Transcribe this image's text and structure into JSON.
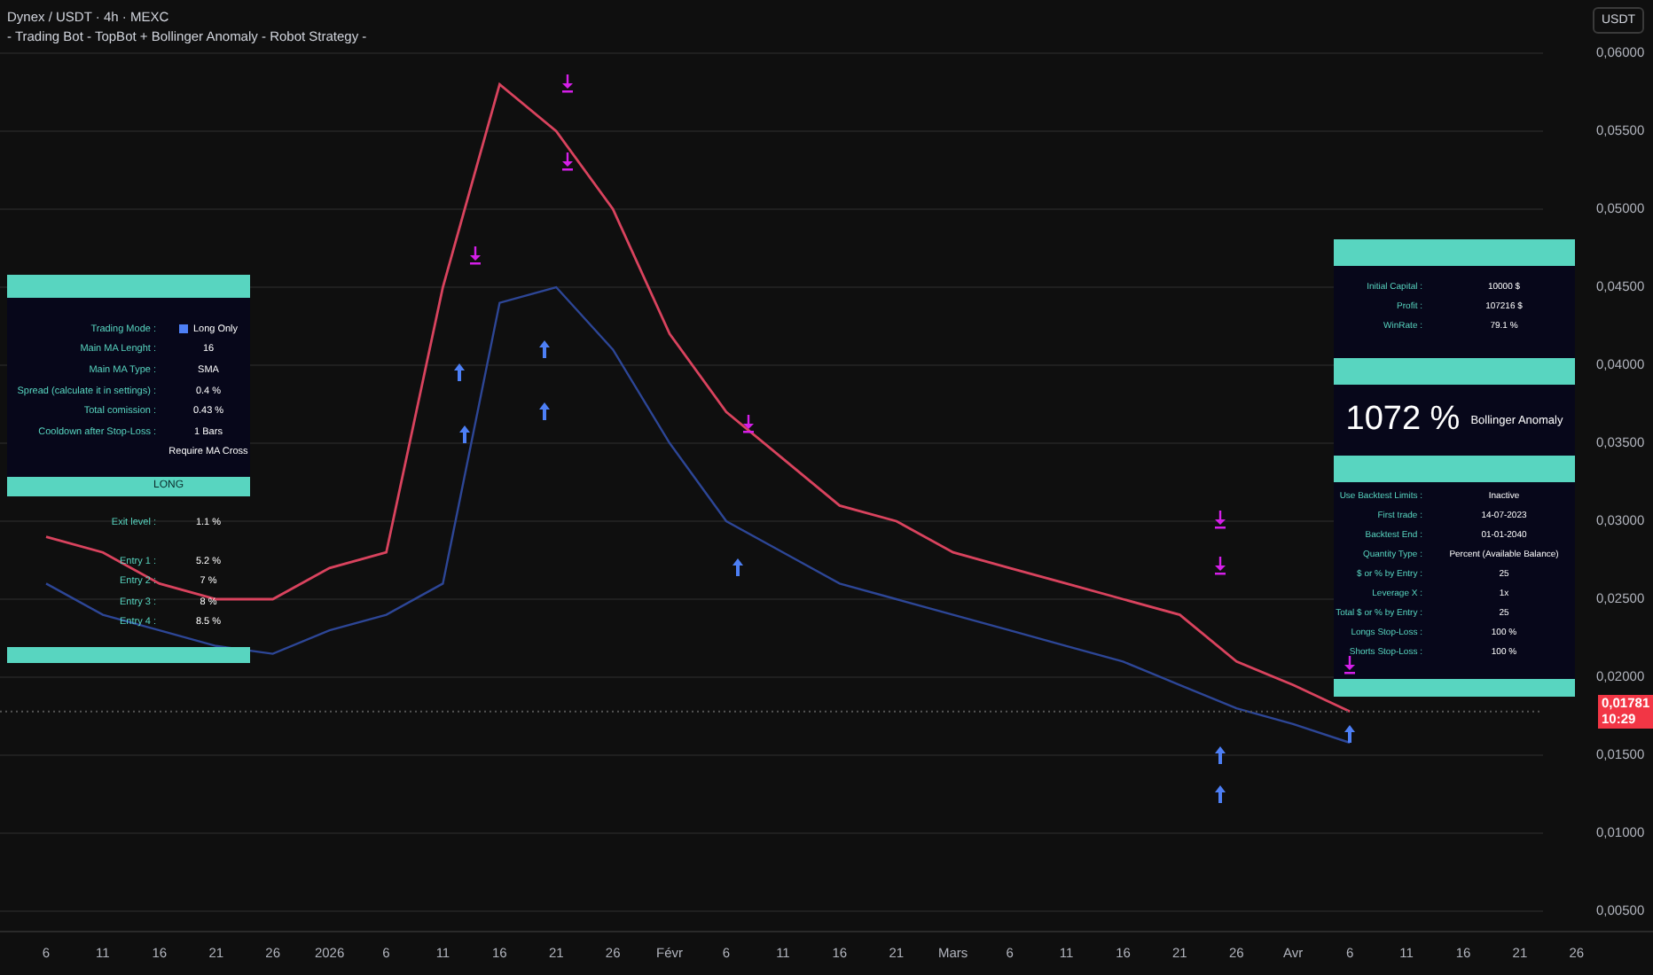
{
  "header": {
    "symbol": "Dynex / USDT · 4h · MEXC",
    "strategy": "- Trading Bot - TopBot + Bollinger Anomaly - Robot Strategy -"
  },
  "currency_button": "USDT",
  "chart_data": {
    "type": "line",
    "ylim": [
      0.005,
      0.06
    ],
    "grid": true,
    "categories": [
      "6",
      "11",
      "16",
      "21",
      "26",
      "2026",
      "6",
      "11",
      "16",
      "21",
      "26",
      "Févr",
      "6",
      "11",
      "16",
      "21",
      "Mars",
      "6",
      "11",
      "16",
      "21",
      "26",
      "Avr",
      "6",
      "11",
      "16",
      "21",
      "26"
    ],
    "series": [
      {
        "color": "#d9435e",
        "values": [
          0.029,
          0.028,
          0.026,
          0.025,
          0.025,
          0.027,
          0.028,
          0.045,
          0.058,
          0.055,
          0.05,
          0.042,
          0.037,
          0.034,
          0.031,
          0.03,
          0.028,
          0.027,
          0.026,
          0.025,
          0.024,
          0.021,
          0.0195,
          0.0178,
          null,
          null,
          null,
          null
        ]
      },
      {
        "color": "#2d4696",
        "values": [
          0.026,
          0.024,
          0.023,
          0.022,
          0.0215,
          0.023,
          0.024,
          0.026,
          0.044,
          0.045,
          0.041,
          0.035,
          0.03,
          0.028,
          0.026,
          0.025,
          0.024,
          0.023,
          0.022,
          0.021,
          0.0195,
          0.018,
          0.017,
          0.0158,
          null,
          null,
          null,
          null
        ]
      }
    ],
    "yticks": [
      {
        "value": 0.06,
        "label": "0,06000"
      },
      {
        "value": 0.055,
        "label": "0,05500"
      },
      {
        "value": 0.05,
        "label": "0,05000"
      },
      {
        "value": 0.045,
        "label": "0,04500"
      },
      {
        "value": 0.04,
        "label": "0,04000"
      },
      {
        "value": 0.035,
        "label": "0,03500"
      },
      {
        "value": 0.03,
        "label": "0,03000"
      },
      {
        "value": 0.025,
        "label": "0,02500"
      },
      {
        "value": 0.02,
        "label": "0,02000"
      },
      {
        "value": 0.015,
        "label": "0,01500"
      },
      {
        "value": 0.01,
        "label": "0,01000"
      },
      {
        "value": 0.005,
        "label": "0,00500"
      }
    ]
  },
  "last_price": {
    "price": "0,01781",
    "countdown": "10:29"
  },
  "settings_panel": {
    "rows": [
      {
        "label": "Trading Mode :",
        "value": "Long Only",
        "kind": "swatch"
      },
      {
        "label": "Main MA Lenght :",
        "value": "16"
      },
      {
        "label": "Main MA Type :",
        "value": "SMA"
      },
      {
        "label": "Spread (calculate it in settings) :",
        "value": "0.4 %"
      },
      {
        "label": "Total comission :",
        "value": "0.43 %"
      },
      {
        "label": "Cooldown after Stop-Loss :",
        "value": "1 Bars"
      },
      {
        "value": "Require MA Cross"
      }
    ],
    "section": "LONG",
    "levels": [
      {
        "label": "Exit level :",
        "value": "1.1 %"
      },
      {
        "label": "Entry 1 :",
        "value": "5.2 %"
      },
      {
        "label": "Entry 2 :",
        "value": "7 %"
      },
      {
        "label": "Entry 3 :",
        "value": "8 %"
      },
      {
        "label": "Entry 4 :",
        "value": "8.5 %"
      }
    ]
  },
  "results_panel": {
    "stats": [
      {
        "label": "Initial Capital :",
        "value": "10000 $"
      },
      {
        "label": "Profit :",
        "value": "107216 $"
      },
      {
        "label": "WinRate :",
        "value": "79.1 %"
      }
    ],
    "return": "1072 %",
    "strategy_name": "Bollinger Anomaly",
    "settings": [
      {
        "label": "Use Backtest Limits :",
        "value": "Inactive"
      },
      {
        "label": "First trade :",
        "value": "14-07-2023"
      },
      {
        "label": "Backtest End :",
        "value": "01-01-2040"
      },
      {
        "label": "Quantity Type :",
        "value": "Percent (Available Balance)"
      },
      {
        "label": "$ or % by Entry :",
        "value": "25"
      },
      {
        "label": "Leverage X :",
        "value": "1x"
      },
      {
        "label": "Total $ or % by Entry :",
        "value": "25"
      },
      {
        "label": "Longs Stop-Loss :",
        "value": "100 %"
      },
      {
        "label": "Shorts Stop-Loss :",
        "value": "100 %"
      }
    ]
  }
}
